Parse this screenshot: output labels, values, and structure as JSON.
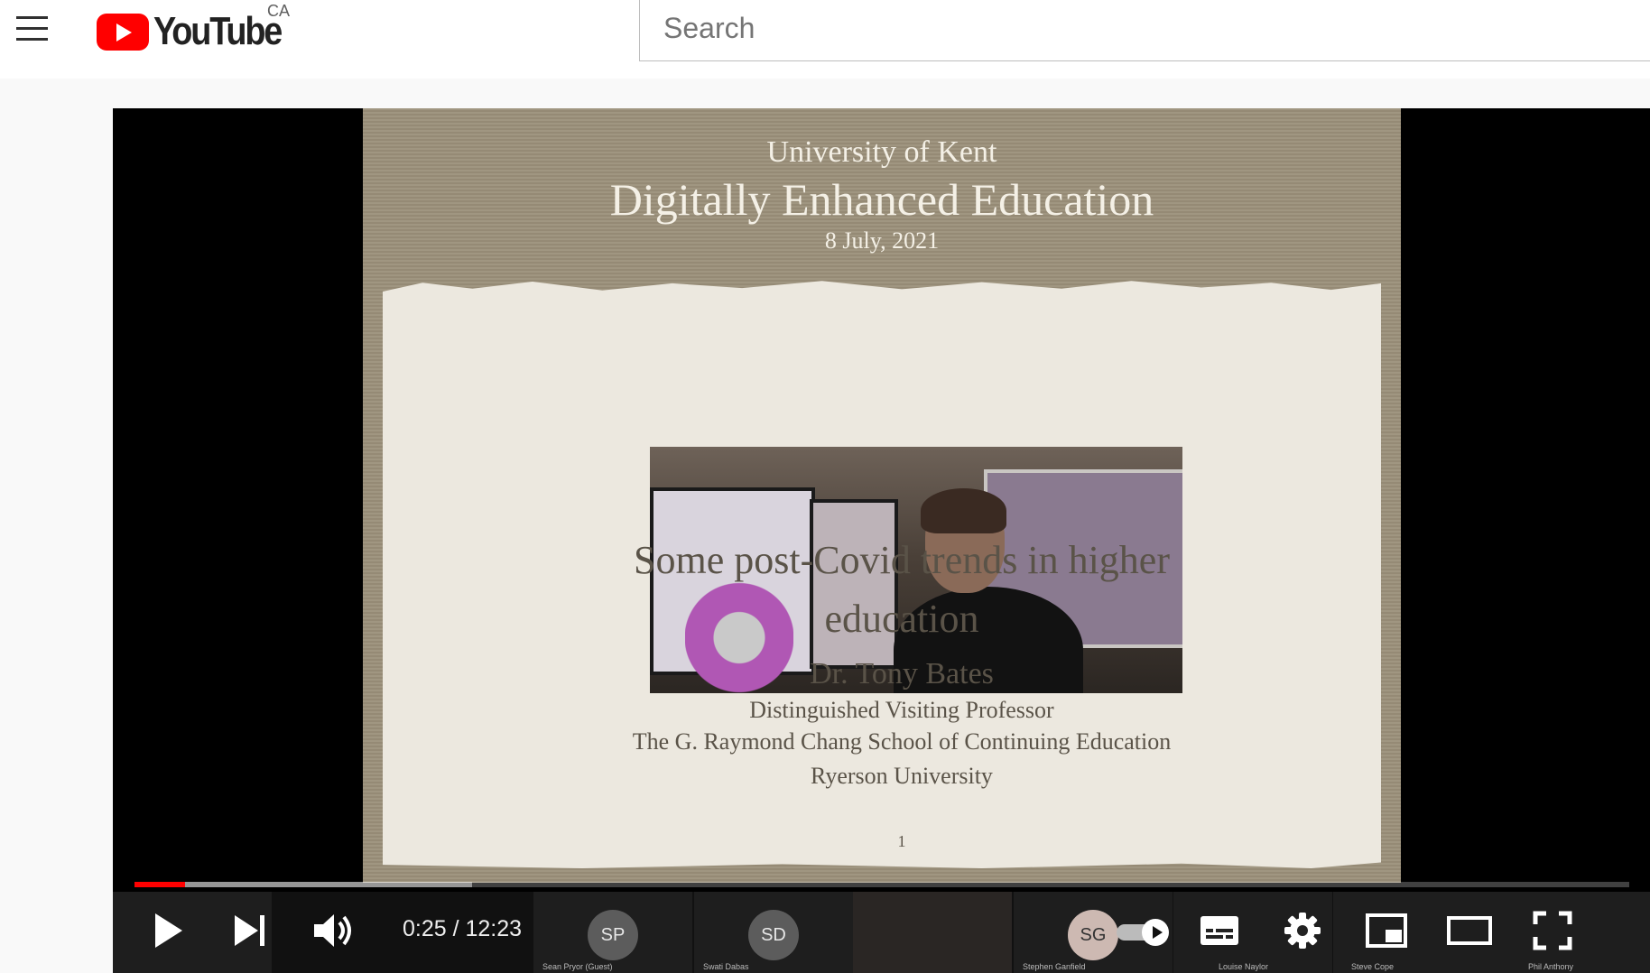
{
  "header": {
    "menu_icon": "hamburger-menu-icon",
    "logo_text": "YouTube",
    "country_code": "CA",
    "search_placeholder": "Search"
  },
  "slide": {
    "university": "University of Kent",
    "event": "Digitally Enhanced Education",
    "date": "8 July, 2021",
    "title_line1": "Some post-Covid trends in higher",
    "title_line2": "education",
    "speaker": "Dr. Tony Bates",
    "role": "Distinguished Visiting Professor",
    "school": "The G. Raymond Chang School of Continuing Education",
    "affiliation": "Ryerson University",
    "page_number": "1"
  },
  "participants": [
    {
      "initials": "",
      "name": "Sean Pryor (Guest)"
    },
    {
      "initials": "SP",
      "name": "Sean Pryor (Guest)"
    },
    {
      "initials": "SD",
      "name": "Swati Dabas"
    },
    {
      "initials": "",
      "name": ""
    },
    {
      "initials": "SG",
      "name": "Stephen Ganfield"
    },
    {
      "initials": "",
      "name": "Louise Naylor"
    },
    {
      "initials": "",
      "name": "Steve Cope"
    },
    {
      "initials": "",
      "name": "Phil Anthony"
    }
  ],
  "player": {
    "time_display": "0:25 / 12:23",
    "progress_fraction": 0.034,
    "buffered_fraction": 0.226,
    "autoplay_on": true
  },
  "colors": {
    "brand_red": "#ff0000",
    "slide_bg": "#9b907a",
    "paper": "#ece8df"
  }
}
